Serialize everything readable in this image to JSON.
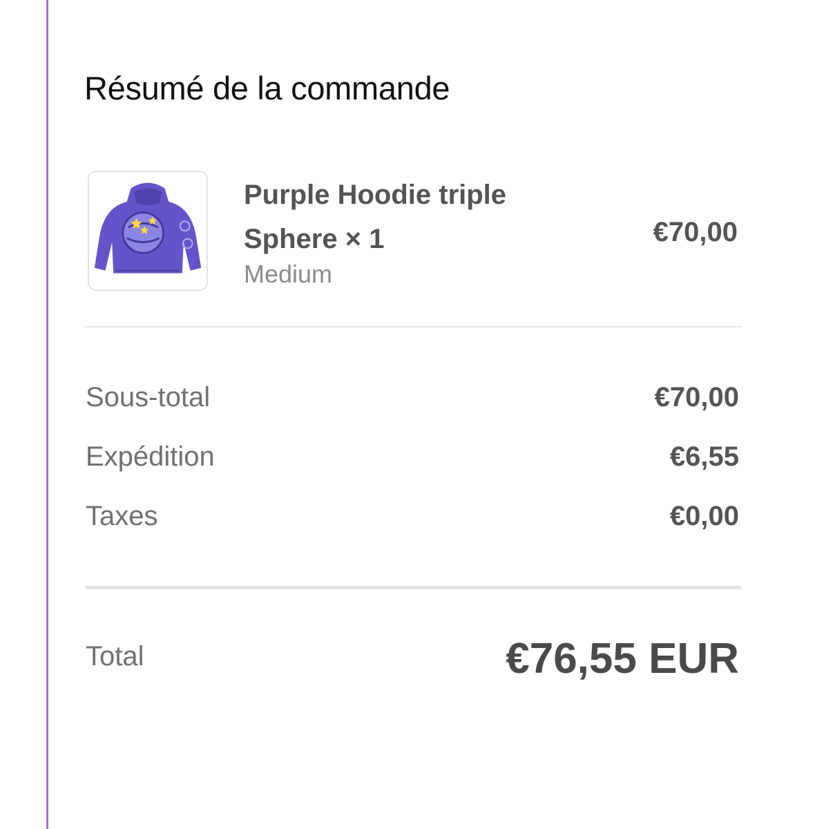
{
  "summary": {
    "title": "Résumé de la commande"
  },
  "item": {
    "image_icon": "purple-hoodie-product-photo",
    "name": "Purple Hoodie triple Sphere × 1",
    "variant": "Medium",
    "price": "€70,00"
  },
  "costs": {
    "subtotal": {
      "label": "Sous-total",
      "value": "€70,00"
    },
    "shipping": {
      "label": "Expédition",
      "value": "€6,55"
    },
    "taxes": {
      "label": "Taxes",
      "value": "€0,00"
    }
  },
  "total": {
    "label": "Total",
    "value": "€76,55 EUR"
  },
  "colors": {
    "accent_rule": "#a070d8",
    "hoodie": "#6355c9"
  }
}
